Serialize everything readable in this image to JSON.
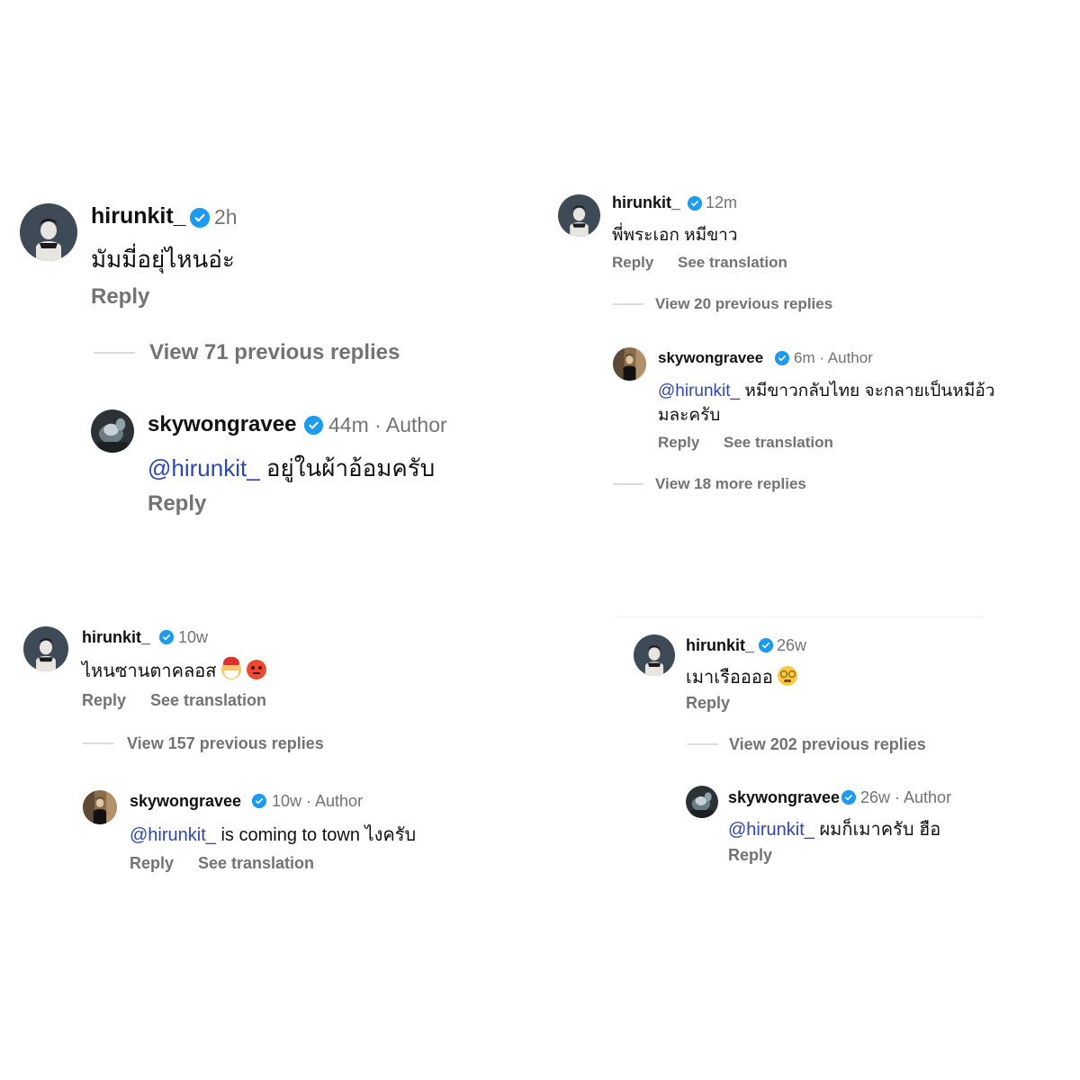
{
  "panels": [
    {
      "comment": {
        "username": "hirunkit_",
        "time": "2h",
        "text": "มัมมี่อยุ่ไหนอ่ะ",
        "reply_label": "Reply"
      },
      "view_replies": "View 71 previous replies",
      "reply": {
        "username": "skywongravee",
        "time": "44m · Author",
        "mention": "@hirunkit_",
        "text": " อยู่ในผ้าอ้อมครับ",
        "reply_label": "Reply"
      }
    },
    {
      "comment": {
        "username": "hirunkit_",
        "time": "12m",
        "text": "พี่พระเอก หมีขาว",
        "reply_label": "Reply",
        "translate_label": "See translation"
      },
      "view_replies": "View 20 previous replies",
      "reply": {
        "username": "skywongravee",
        "time": "6m · Author",
        "mention": "@hirunkit_",
        "text": " หมีขาวกลับไทย จะกลายเป็นหมีอ้ว",
        "text_line2": "มละครับ",
        "reply_label": "Reply",
        "translate_label": "See translation"
      },
      "view_more": "View 18 more replies"
    },
    {
      "comment": {
        "username": "hirunkit_",
        "time": "10w",
        "text": "ไหนซานตาคลอส",
        "emojis": [
          "santa-emoji",
          "angry-face-emoji"
        ],
        "reply_label": "Reply",
        "translate_label": "See translation"
      },
      "view_replies": "View 157 previous replies",
      "reply": {
        "username": "skywongravee",
        "time": "10w · Author",
        "mention": "@hirunkit_",
        "text": " is coming to town ไงครับ",
        "reply_label": "Reply",
        "translate_label": "See translation"
      }
    },
    {
      "comment": {
        "username": "hirunkit_",
        "time": "26w",
        "text": "เมาเรืออออ",
        "emojis": [
          "dizzy-face-emoji"
        ],
        "reply_label": "Reply"
      },
      "view_replies": "View 202 previous replies",
      "reply": {
        "username": "skywongravee",
        "time": "26w · Author",
        "mention": "@hirunkit_",
        "text": " ผมก็เมาครับ ฮือ",
        "reply_label": "Reply"
      }
    }
  ],
  "colors": {
    "verified": "#1d9bf0",
    "mention": "#2f46b8",
    "secondary_text": "#737373"
  }
}
